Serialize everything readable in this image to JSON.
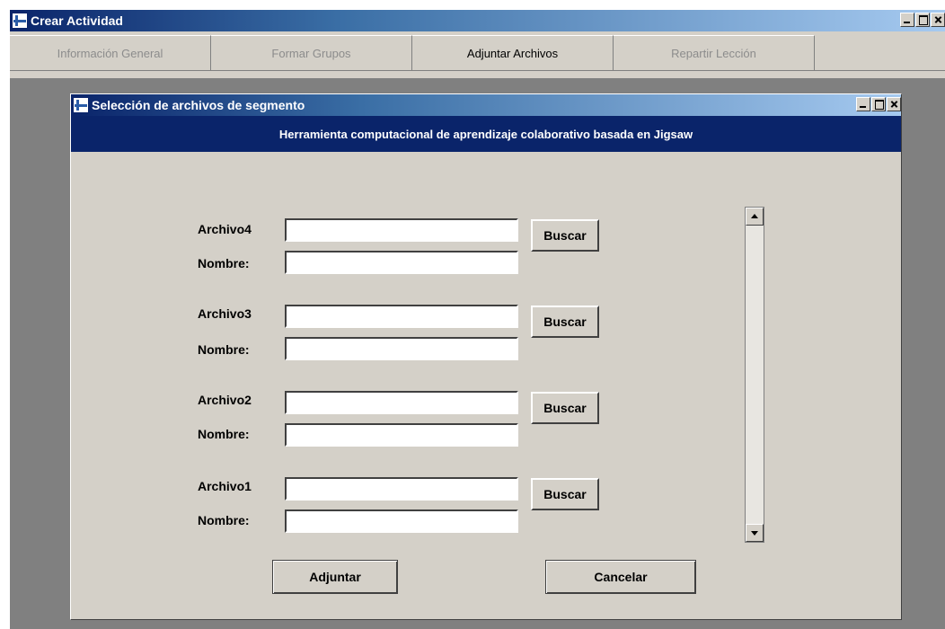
{
  "main_window": {
    "title": "Crear Actividad"
  },
  "tabs": [
    {
      "label": "Información General",
      "active": false
    },
    {
      "label": "Formar Grupos",
      "active": false
    },
    {
      "label": "Adjuntar Archivos",
      "active": true
    },
    {
      "label": "Repartir Lección",
      "active": false
    }
  ],
  "dialog": {
    "title": "Selección de archivos de segmento",
    "banner": "Herramienta computacional de aprendizaje colaborativo basada en Jigsaw",
    "rows": [
      {
        "file_label": "Archivo4",
        "name_label": "Nombre:",
        "file_value": "",
        "name_value": "",
        "search_label": "Buscar"
      },
      {
        "file_label": "Archivo3",
        "name_label": "Nombre:",
        "file_value": "",
        "name_value": "",
        "search_label": "Buscar"
      },
      {
        "file_label": "Archivo2",
        "name_label": "Nombre:",
        "file_value": "",
        "name_value": "",
        "search_label": "Buscar"
      },
      {
        "file_label": "Archivo1",
        "name_label": "Nombre:",
        "file_value": "",
        "name_value": "",
        "search_label": "Buscar"
      }
    ],
    "attach_label": "Adjuntar",
    "cancel_label": "Cancelar"
  },
  "colors": {
    "titlebar_start": "#0a246a",
    "titlebar_end": "#a6caf0",
    "banner": "#0a246a",
    "face": "#d4d0c8",
    "workspace": "#808080"
  },
  "icons": [
    "app-icon",
    "minimize-icon",
    "maximize-icon",
    "close-icon",
    "scroll-up-arrow-icon",
    "scroll-down-arrow-icon"
  ]
}
